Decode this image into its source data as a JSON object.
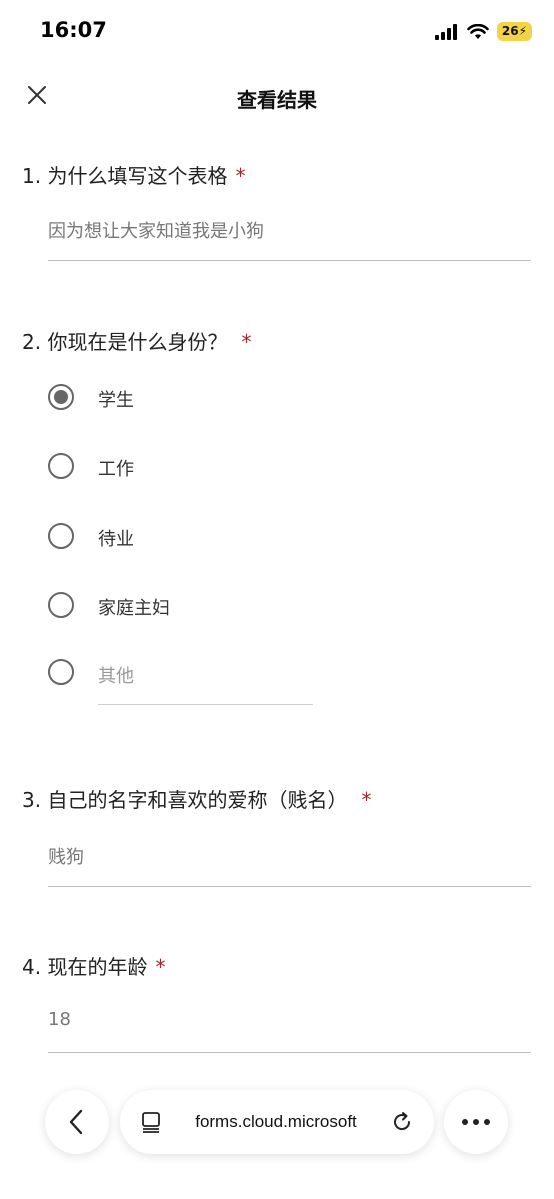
{
  "status": {
    "time": "16:07",
    "battery": "26"
  },
  "header": {
    "title": "查看结果"
  },
  "questions": [
    {
      "number": "1.",
      "title": "为什么填写这个表格",
      "required": "*",
      "answer": "因为想让大家知道我是小狗"
    },
    {
      "number": "2.",
      "title": "你现在是什么身份？",
      "required": "*",
      "options": [
        "学生",
        "工作",
        "待业",
        "家庭主妇",
        "其他"
      ],
      "selected": "学生"
    },
    {
      "number": "3.",
      "title": "自己的名字和喜欢的爱称（贱名）",
      "required": "*",
      "answer": "贱狗"
    },
    {
      "number": "4.",
      "title": "现在的年龄",
      "required": "*",
      "answer": "18"
    }
  ],
  "browser": {
    "url": "forms.cloud.microsoft"
  },
  "icons": {
    "close": "close-icon",
    "back": "chevron-left-icon",
    "tabs": "tabs-icon",
    "reload": "reload-icon",
    "more": "more-icon"
  },
  "colors": {
    "required": "#a4262c",
    "battery": "#f3d34a"
  }
}
